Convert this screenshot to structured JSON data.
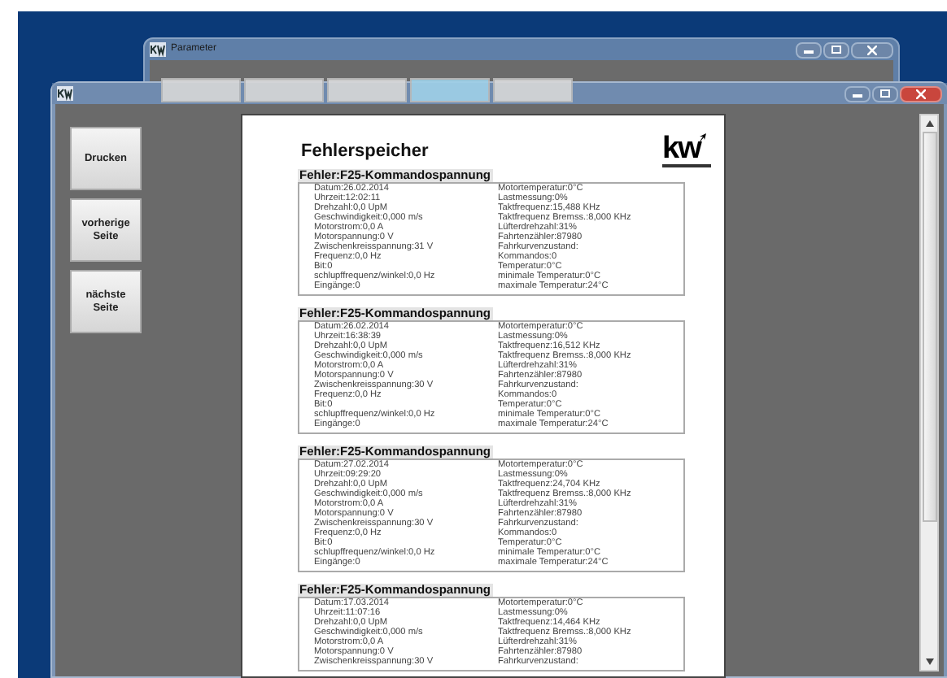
{
  "back_window": {
    "title": "Parameter",
    "tabs": [
      {
        "selected": false
      },
      {
        "selected": false
      },
      {
        "selected": false
      },
      {
        "selected": true
      },
      {
        "selected": false
      }
    ]
  },
  "buttons": [
    "Drucken",
    "vorherige Seite",
    "nächste Seite"
  ],
  "report": {
    "title": "Fehlerspeicher",
    "logo": {
      "mark": "kw"
    },
    "records": [
      {
        "heading": "Fehler:F25-Kommandospannung",
        "left": [
          "Datum:26.02.2014",
          "Uhrzeit:12:02:11",
          "Drehzahl:0,0 UpM",
          "Geschwindigkeit:0,000 m/s",
          "Motorstrom:0,0 A",
          "Motorspannung:0 V",
          "Zwischenkreisspannung:31 V",
          "Frequenz:0,0 Hz",
          "Bit:0",
          "schlupffrequenz/winkel:0,0 Hz",
          "Eingänge:0"
        ],
        "right": [
          "Motortemperatur:0°C",
          "Lastmessung:0%",
          "Taktfrequenz:15,488 KHz",
          "Taktfrequenz Bremss.:8,000 KHz",
          "Lüfterdrehzahl:31%",
          "Fahrtenzähler:87980",
          "Fahrkurvenzustand:",
          "Kommandos:0",
          "Temperatur:0°C",
          "minimale Temperatur:0°C",
          "maximale Temperatur:24°C"
        ]
      },
      {
        "heading": "Fehler:F25-Kommandospannung",
        "left": [
          "Datum:26.02.2014",
          "Uhrzeit:16:38:39",
          "Drehzahl:0,0 UpM",
          "Geschwindigkeit:0,000 m/s",
          "Motorstrom:0,0 A",
          "Motorspannung:0 V",
          "Zwischenkreisspannung:30 V",
          "Frequenz:0,0 Hz",
          "Bit:0",
          "schlupffrequenz/winkel:0,0 Hz",
          "Eingänge:0"
        ],
        "right": [
          "Motortemperatur:0°C",
          "Lastmessung:0%",
          "Taktfrequenz:16,512 KHz",
          "Taktfrequenz Bremss.:8,000 KHz",
          "Lüfterdrehzahl:31%",
          "Fahrtenzähler:87980",
          "Fahrkurvenzustand:",
          "Kommandos:0",
          "Temperatur:0°C",
          "minimale Temperatur:0°C",
          "maximale Temperatur:24°C"
        ]
      },
      {
        "heading": "Fehler:F25-Kommandospannung",
        "left": [
          "Datum:27.02.2014",
          "Uhrzeit:09:29:20",
          "Drehzahl:0,0 UpM",
          "Geschwindigkeit:0,000 m/s",
          "Motorstrom:0,0 A",
          "Motorspannung:0 V",
          "Zwischenkreisspannung:30 V",
          "Frequenz:0,0 Hz",
          "Bit:0",
          "schlupffrequenz/winkel:0,0 Hz",
          "Eingänge:0"
        ],
        "right": [
          "Motortemperatur:0°C",
          "Lastmessung:0%",
          "Taktfrequenz:24,704 KHz",
          "Taktfrequenz Bremss.:8,000 KHz",
          "Lüfterdrehzahl:31%",
          "Fahrtenzähler:87980",
          "Fahrkurvenzustand:",
          "Kommandos:0",
          "Temperatur:0°C",
          "minimale Temperatur:0°C",
          "maximale Temperatur:24°C"
        ]
      },
      {
        "heading": "Fehler:F25-Kommandospannung",
        "left": [
          "Datum:17.03.2014",
          "Uhrzeit:11:07:16",
          "Drehzahl:0,0 UpM",
          "Geschwindigkeit:0,000 m/s",
          "Motorstrom:0,0 A",
          "Motorspannung:0 V",
          "Zwischenkreisspannung:30 V"
        ],
        "right": [
          "Motortemperatur:0°C",
          "Lastmessung:0%",
          "Taktfrequenz:14,464 KHz",
          "Taktfrequenz Bremss.:8,000 KHz",
          "Lüfterdrehzahl:31%",
          "Fahrtenzähler:87980",
          "Fahrkurvenzustand:"
        ]
      }
    ]
  }
}
